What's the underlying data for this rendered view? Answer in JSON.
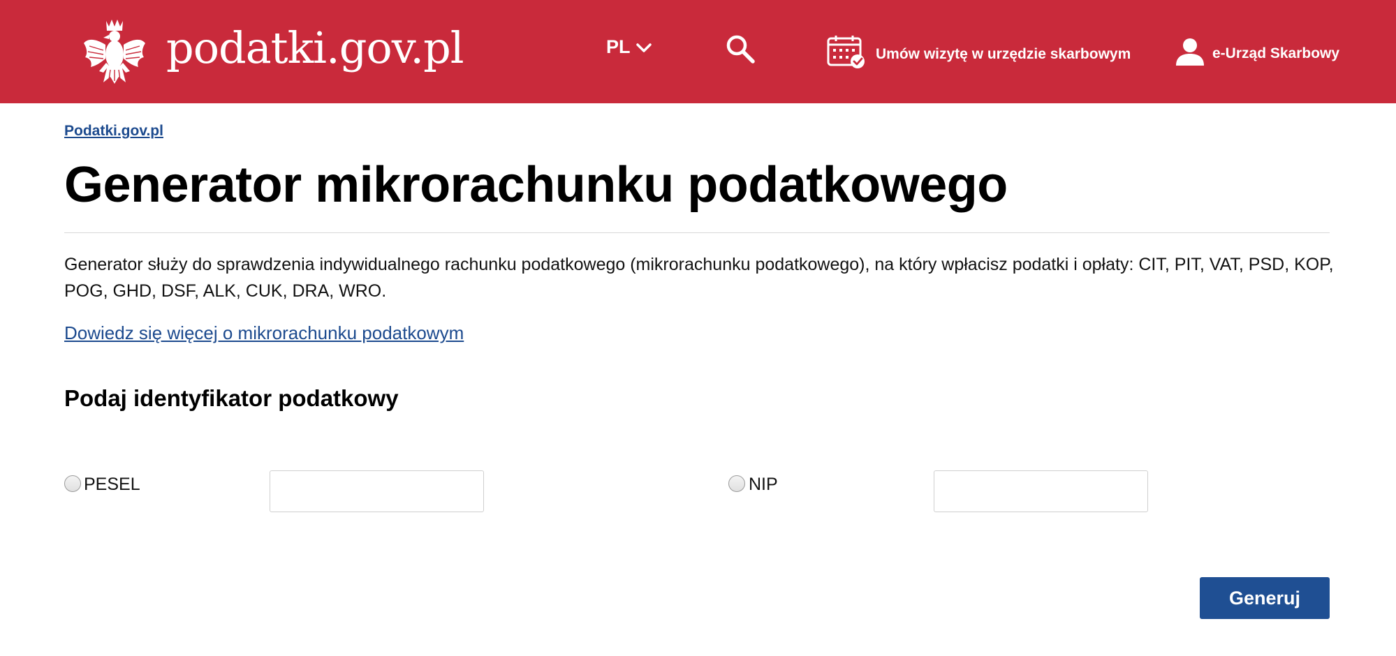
{
  "header": {
    "logo_text": "podatki.gov.pl",
    "lang": "PL",
    "visit_label": "Umów wizytę w urzędzie skarbowym",
    "eus_label": "e-Urząd Skarbowy",
    "brand_color": "#c92a3b",
    "icons": {
      "emblem": "polish-eagle-icon",
      "lang_chevron": "chevron-down-icon",
      "search": "search-icon",
      "calendar": "calendar-check-icon",
      "user": "user-icon"
    }
  },
  "breadcrumb": {
    "home": "Podatki.gov.pl"
  },
  "main": {
    "title": "Generator mikrorachunku podatkowego",
    "description": "Generator służy do sprawdzenia indywidualnego rachunku podatkowego (mikrorachunku podatkowego), na który wpłacisz podatki i opłaty: CIT, PIT, VAT, PSD, KOP, POG, GHD, DSF, ALK, CUK, DRA, WRO.",
    "more_link": "Dowiedz się więcej o mikrorachunku podatkowym",
    "section_title": "Podaj identyfikator podatkowy"
  },
  "form": {
    "pesel_label": "PESEL",
    "pesel_value": "",
    "nip_label": "NIP",
    "nip_value": "",
    "generate_label": "Generuj",
    "button_color": "#1f4f93"
  }
}
